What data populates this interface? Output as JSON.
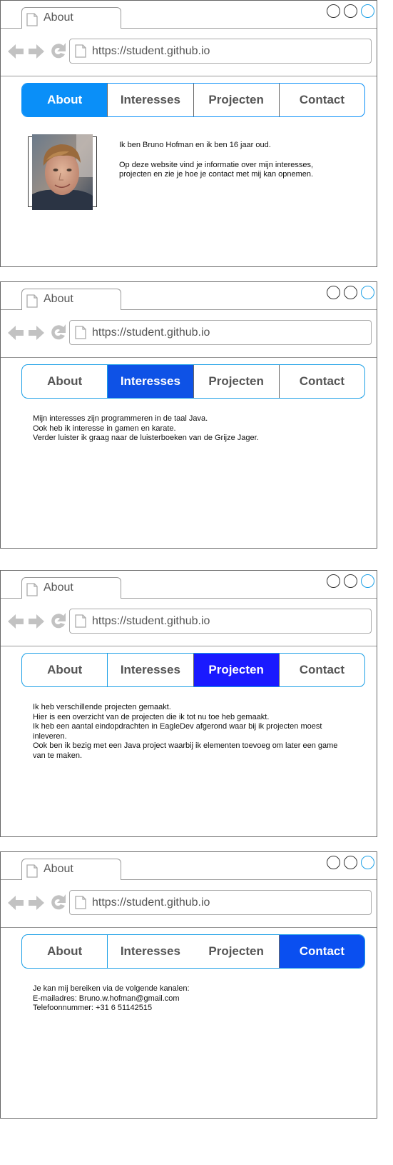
{
  "browser": {
    "tab_title": "About",
    "url": "https://student.github.io"
  },
  "menu": {
    "items": [
      "About",
      "Interesses",
      "Projecten",
      "Contact"
    ]
  },
  "pages": [
    {
      "active": "About",
      "photo": "portrait-photo",
      "paragraphs": [
        "Ik ben Bruno Hofman en ik ben 16 jaar oud.",
        "Op deze website vind je informatie over mijn interesses, projecten en zie je hoe je contact met mij kan opnemen."
      ]
    },
    {
      "active": "Interesses",
      "lines": [
        "Mijn interesses zijn programmeren in de taal Java.",
        "Ook heb ik interesse in gamen en karate.",
        "Verder luister ik graag naar de luisterboeken van de Grijze Jager."
      ]
    },
    {
      "active": "Projecten",
      "lines": [
        "Ik heb verschillende projecten gemaakt.",
        "Hier is een overzicht van de projecten die ik tot nu toe heb gemaakt.",
        "Ik heb een aantal eindopdrachten in EagleDev afgerond waar bij ik projecten moest inleveren.",
        "Ook ben ik bezig met een Java project waarbij ik elementen toevoeg om later een game van te maken."
      ]
    },
    {
      "active": "Contact",
      "lines": [
        "Je kan mij bereiken via de volgende kanalen:",
        "E-mailadres: Bruno.w.hofman@gmail.com",
        "Telefoonnummer: +31 6 51142515"
      ]
    }
  ],
  "colors": {
    "about_active": "#0a8ff8",
    "interesses_active": "#0e52e6",
    "projecten_active": "#1a1aff",
    "contact_active": "#0a4ff0",
    "accent_circle": "#1a9fe6"
  },
  "icons": [
    "page-icon",
    "back-arrow-icon",
    "forward-arrow-icon",
    "reload-icon",
    "window-button-icon"
  ]
}
